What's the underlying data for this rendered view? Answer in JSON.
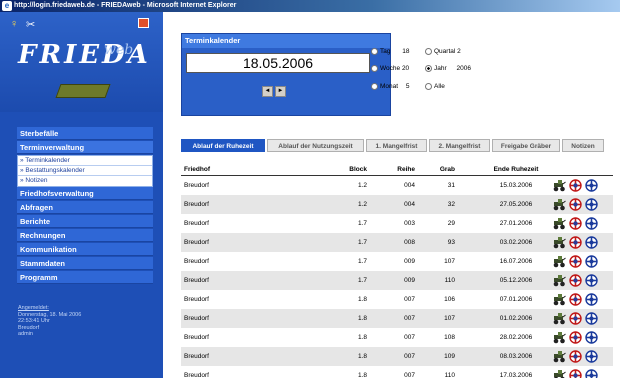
{
  "window": {
    "title": "http://login.friedaweb.de - FRIEDAweb - Microsoft Internet Explorer"
  },
  "logo": {
    "name": "FRIEDA",
    "suffix": "web"
  },
  "menu": {
    "items": [
      {
        "label": "Sterbefälle"
      },
      {
        "label": "Terminverwaltung"
      }
    ],
    "submenu": [
      {
        "label": "» Terminkalender"
      },
      {
        "label": "» Bestattungskalender"
      },
      {
        "label": "» Notizen"
      }
    ],
    "items2": [
      {
        "label": "Friedhofsverwaltung"
      },
      {
        "label": "Abfragen"
      },
      {
        "label": "Berichte"
      },
      {
        "label": "Rechnungen"
      },
      {
        "label": "Kommunikation"
      },
      {
        "label": "Stammdaten"
      },
      {
        "label": "Programm"
      }
    ]
  },
  "login": {
    "label": "Angemeldet:",
    "date": "Donnerstag, 18. Mai 2006",
    "time": "22:53:41 Uhr",
    "place": "Breudorf",
    "user": "admin"
  },
  "calendar": {
    "title": "Terminkalender",
    "date": "18.05.2006",
    "prev": "◄",
    "next": "►",
    "options": [
      {
        "label": "Tag",
        "value": "18",
        "selected": false
      },
      {
        "label": "Quartal",
        "value": "2",
        "selected": false
      },
      {
        "label": "Woche",
        "value": "20",
        "selected": false
      },
      {
        "label": "Jahr",
        "value": "2006",
        "selected": true
      },
      {
        "label": "Monat",
        "value": "5",
        "selected": false
      },
      {
        "label": "Alle",
        "value": "",
        "selected": false
      }
    ]
  },
  "tabs": [
    {
      "label": "Ablauf der Ruhezeit",
      "active": true
    },
    {
      "label": "Ablauf der Nutzungszeit",
      "active": false
    },
    {
      "label": "1. Mangelfrist",
      "active": false
    },
    {
      "label": "2. Mangelfrist",
      "active": false
    },
    {
      "label": "Freigabe Gräber",
      "active": false
    },
    {
      "label": "Notizen",
      "active": false
    }
  ],
  "table": {
    "headers": {
      "friedhof": "Friedhof",
      "block": "Block",
      "reihe": "Reihe",
      "grab": "Grab",
      "ende": "Ende Ruhezeit"
    },
    "rows": [
      {
        "friedhof": "Breudorf",
        "block": "1.2",
        "reihe": "004",
        "grab": "31",
        "ende": "15.03.2006"
      },
      {
        "friedhof": "Breudorf",
        "block": "1.2",
        "reihe": "004",
        "grab": "32",
        "ende": "27.05.2006"
      },
      {
        "friedhof": "Breudorf",
        "block": "1.7",
        "reihe": "003",
        "grab": "29",
        "ende": "27.01.2006"
      },
      {
        "friedhof": "Breudorf",
        "block": "1.7",
        "reihe": "008",
        "grab": "93",
        "ende": "03.02.2006"
      },
      {
        "friedhof": "Breudorf",
        "block": "1.7",
        "reihe": "009",
        "grab": "107",
        "ende": "16.07.2006"
      },
      {
        "friedhof": "Breudorf",
        "block": "1.7",
        "reihe": "009",
        "grab": "110",
        "ende": "05.12.2006"
      },
      {
        "friedhof": "Breudorf",
        "block": "1.8",
        "reihe": "007",
        "grab": "106",
        "ende": "07.01.2006"
      },
      {
        "friedhof": "Breudorf",
        "block": "1.8",
        "reihe": "007",
        "grab": "107",
        "ende": "01.02.2006"
      },
      {
        "friedhof": "Breudorf",
        "block": "1.8",
        "reihe": "007",
        "grab": "108",
        "ende": "28.02.2006"
      },
      {
        "friedhof": "Breudorf",
        "block": "1.8",
        "reihe": "007",
        "grab": "109",
        "ende": "08.03.2006"
      },
      {
        "friedhof": "Breudorf",
        "block": "1.8",
        "reihe": "007",
        "grab": "110",
        "ende": "17.03.2006"
      }
    ]
  },
  "colors": {
    "sidebar": "#1e4fb6",
    "accent": "#1f56c3",
    "row_alt": "#e6e6e6"
  }
}
